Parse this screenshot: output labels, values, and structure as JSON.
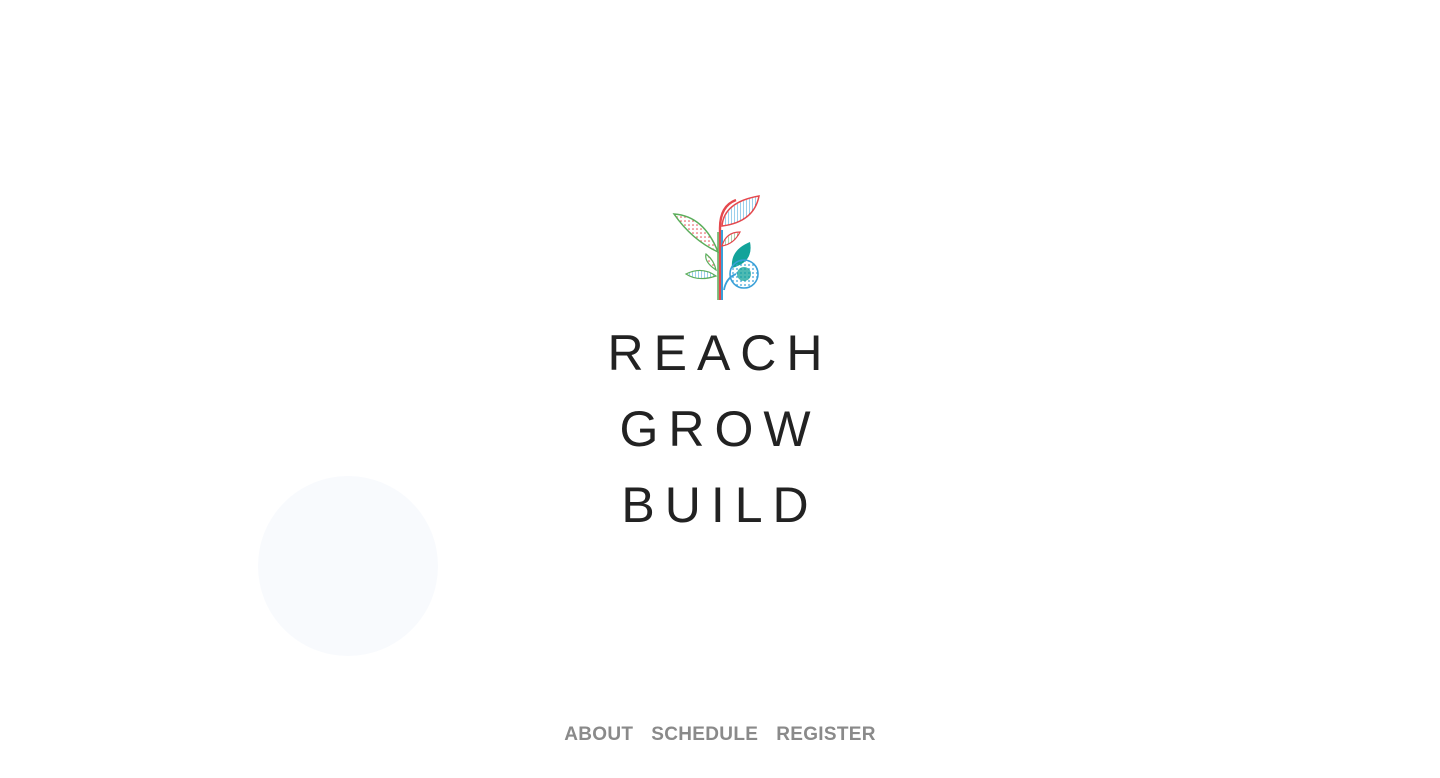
{
  "hero": {
    "logo_icon": "plant-sprout-icon",
    "lines": [
      "REACH",
      "GROW",
      "BUILD"
    ]
  },
  "nav": {
    "items": [
      "ABOUT",
      "SCHEDULE",
      "REGISTER"
    ]
  },
  "colors": {
    "text_dark": "#222222",
    "nav_gray": "#8a8a8a",
    "leaf_green": "#5cae5c",
    "leaf_red": "#e5484d",
    "leaf_teal": "#12a39a",
    "leaf_blue": "#3aa0d8"
  }
}
